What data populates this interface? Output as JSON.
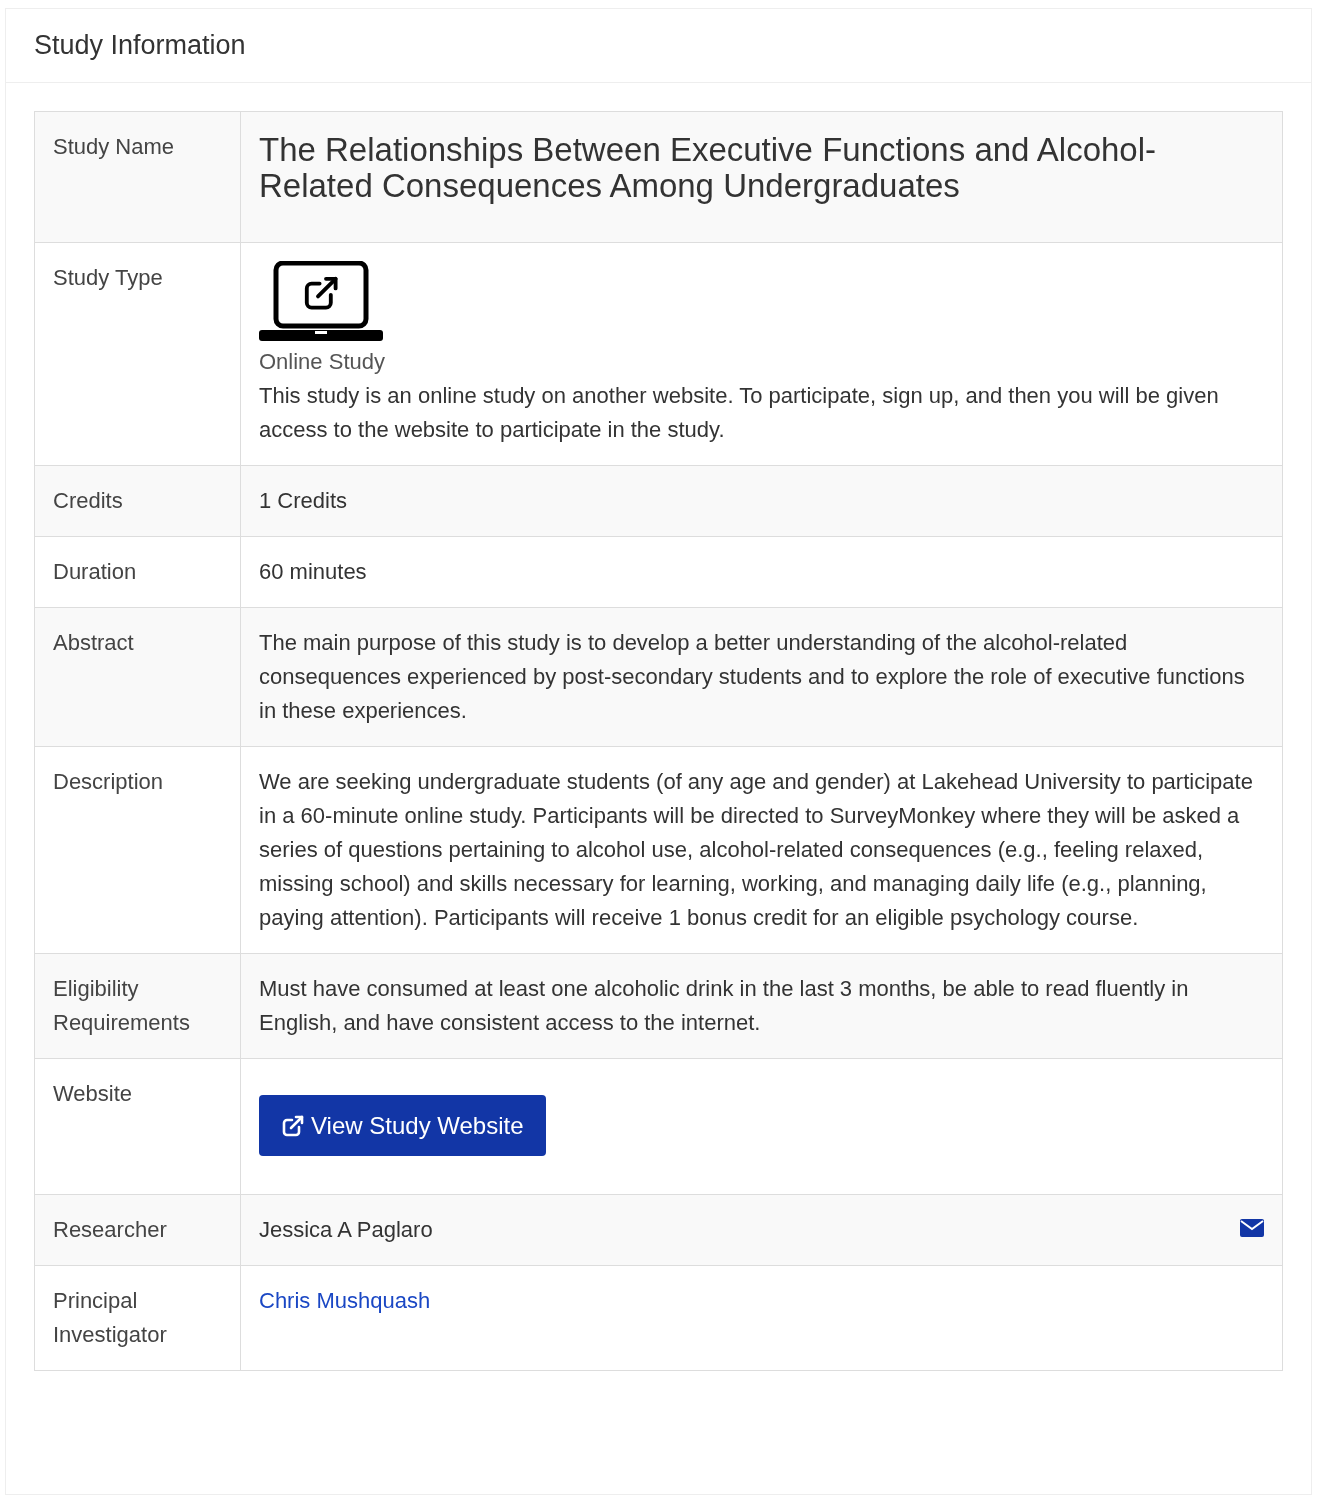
{
  "panel": {
    "title": "Study Information"
  },
  "rows": [
    {
      "label": "Study Name",
      "kind": "title",
      "value": "The Relationships Between Executive Functions and Alcohol-Related Consequences Among Undergraduates"
    },
    {
      "label": "Study Type",
      "kind": "study_type",
      "type_name": "Online Study",
      "value": "This study is an online study on another website. To participate, sign up, and then you will be given access to the website to participate in the study."
    },
    {
      "label": "Credits",
      "kind": "text",
      "value": "1 Credits"
    },
    {
      "label": "Duration",
      "kind": "text",
      "value": "60 minutes"
    },
    {
      "label": "Abstract",
      "kind": "text",
      "value": "The main purpose of this study is to develop a better understanding of the alcohol-related consequences experienced by post-secondary students and to explore the role of executive functions in these experiences."
    },
    {
      "label": "Description",
      "kind": "text",
      "value": "We are seeking undergraduate students (of any age and gender) at Lakehead University to participate in a 60-minute online study. Participants will be directed to SurveyMonkey where they will be asked a series of questions pertaining to alcohol use, alcohol-related consequences (e.g., feeling relaxed, missing school) and skills necessary for learning, working, and managing daily life (e.g., planning, paying attention). Participants will receive 1 bonus credit for an eligible psychology course."
    },
    {
      "label": "Eligibility Requirements",
      "kind": "text",
      "value": "Must have consumed at least one alcoholic drink in the last 3 months, be able to read fluently in English, and have consistent access to the internet."
    },
    {
      "label": "Website",
      "kind": "button",
      "value": "View Study Website"
    },
    {
      "label": "Researcher",
      "kind": "researcher",
      "value": "Jessica A Paglaro"
    },
    {
      "label": "Principal Investigator",
      "kind": "link",
      "value": "Chris Mushquash"
    }
  ]
}
